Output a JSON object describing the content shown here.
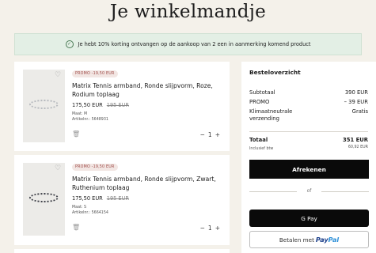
{
  "page": {
    "title": "Je winkelmandje"
  },
  "banner": {
    "text": "Je hebt 10% korting ontvangen op de aankoop van 2 een in aanmerking komend product"
  },
  "items": [
    {
      "promo": "PROMO -19,50 EUR",
      "name": "Matrix Tennis armband, Ronde slijpvorm, Roze, Rodium toplaag",
      "price": "175,50 EUR",
      "old_price": "195 EUR",
      "size": "Maat: M",
      "article": "Artikelnr.: 5648931",
      "quantity": "1",
      "minus": "−",
      "plus": "+"
    },
    {
      "promo": "PROMO -19,50 EUR",
      "name": "Matrix Tennis armband, Ronde slijpvorm, Zwart, Ruthenium toplaag",
      "price": "175,50 EUR",
      "old_price": "195 EUR",
      "size": "Maat: S",
      "article": "Artikelnr.: 5664154",
      "quantity": "1",
      "minus": "−",
      "plus": "+"
    }
  ],
  "summary": {
    "title": "Besteloverzicht",
    "subtotal_label": "Subtotaal",
    "subtotal_value": "390 EUR",
    "promo_label": "PROMO",
    "promo_value": "– 39 EUR",
    "shipping_label": "Klimaatneutrale verzending",
    "shipping_value": "Gratis",
    "total_label": "Totaal",
    "total_value": "351 EUR",
    "vat_label": "Inclusief btw",
    "vat_value": "60,92 EUR",
    "checkout_button": "Afrekenen",
    "or_label": "of",
    "gpay_label": "G Pay",
    "paypal_prefix": "Betalen met",
    "paypal_brand_a": "Pay",
    "paypal_brand_b": "Pal"
  },
  "colors": {
    "background": "#f4f1ea",
    "banner": "#e3efe5",
    "promo_badge": "#f2e6e3",
    "button": "#0a0a0a"
  }
}
